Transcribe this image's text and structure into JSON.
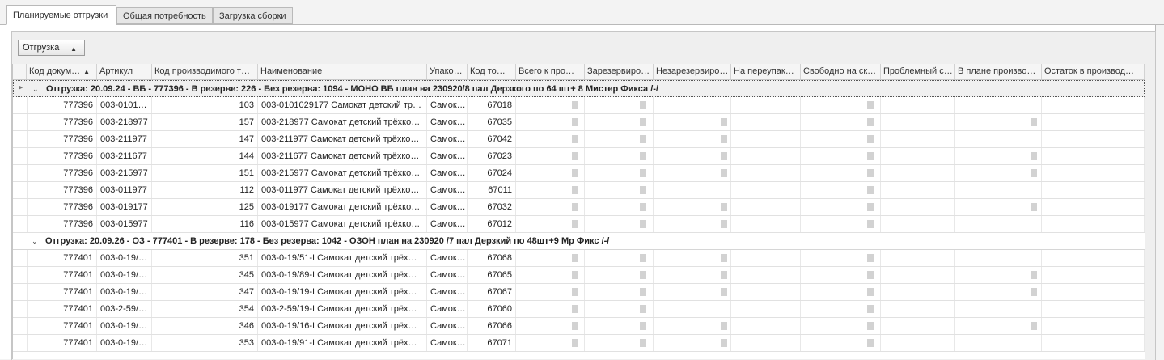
{
  "tabs": [
    {
      "label": "Планируемые отгрузки",
      "active": true
    },
    {
      "label": "Общая потребность",
      "active": false
    },
    {
      "label": "Загрузка сборки",
      "active": false
    }
  ],
  "group_panel": {
    "label": "Отгрузка",
    "sort_icon": "sort-asc-icon"
  },
  "columns": [
    {
      "label": "Код докум…",
      "sorted": true
    },
    {
      "label": "Артикул"
    },
    {
      "label": "Код производимого т…"
    },
    {
      "label": "Наименование"
    },
    {
      "label": "Упако…"
    },
    {
      "label": "Код то…"
    },
    {
      "label": "Всего к про…"
    },
    {
      "label": "Зарезервиро…"
    },
    {
      "label": "Незарезервиро…"
    },
    {
      "label": "На переупак…"
    },
    {
      "label": "Свободно на ск…"
    },
    {
      "label": "Проблемный с…"
    },
    {
      "label": "В плане произво…"
    },
    {
      "label": "Остаток в производ…"
    }
  ],
  "groups": [
    {
      "title": "Отгрузка: 20.09.24 - ВБ - 777396 - В резерве: 226 - Без резерва: 1094 - МОНО ВБ план на 230920/8 пал Дерзкого по 64 шт+ 8 Мистер Фикса /-/",
      "rows": [
        {
          "doc": "777396",
          "article": "003-0101…",
          "prod_code": "103",
          "name": "003-0101029177 Самокат детский тр…",
          "pack": "Самок…",
          "item_code": "67018"
        },
        {
          "doc": "777396",
          "article": "003-218977",
          "prod_code": "157",
          "name": "003-218977 Самокат детский трёхко…",
          "pack": "Самок…",
          "item_code": "67035"
        },
        {
          "doc": "777396",
          "article": "003-211977",
          "prod_code": "147",
          "name": "003-211977 Самокат детский трёхко…",
          "pack": "Самок…",
          "item_code": "67042"
        },
        {
          "doc": "777396",
          "article": "003-211677",
          "prod_code": "144",
          "name": "003-211677 Самокат детский трёхко…",
          "pack": "Самок…",
          "item_code": "67023"
        },
        {
          "doc": "777396",
          "article": "003-215977",
          "prod_code": "151",
          "name": "003-215977 Самокат детский трёхко…",
          "pack": "Самок…",
          "item_code": "67024"
        },
        {
          "doc": "777396",
          "article": "003-011977",
          "prod_code": "112",
          "name": "003-011977 Самокат детский трёхко…",
          "pack": "Самок…",
          "item_code": "67011"
        },
        {
          "doc": "777396",
          "article": "003-019177",
          "prod_code": "125",
          "name": "003-019177 Самокат детский трёхко…",
          "pack": "Самок…",
          "item_code": "67032"
        },
        {
          "doc": "777396",
          "article": "003-015977",
          "prod_code": "116",
          "name": "003-015977 Самокат детский трёхко…",
          "pack": "Самок…",
          "item_code": "67012"
        }
      ]
    },
    {
      "title": "Отгрузка: 20.09.26 - ОЗ - 777401 - В резерве: 178 - Без резерва: 1042 - ОЗОН  план на 230920 /7 пал Дерзкий по 48шт+9 Мр Фикс  /-/",
      "rows": [
        {
          "doc": "777401",
          "article": "003-0-19/…",
          "prod_code": "351",
          "name": "003-0-19/51-I Самокат детский трёх…",
          "pack": "Самок…",
          "item_code": "67068"
        },
        {
          "doc": "777401",
          "article": "003-0-19/…",
          "prod_code": "345",
          "name": "003-0-19/89-I Самокат детский трёх…",
          "pack": "Самок…",
          "item_code": "67065"
        },
        {
          "doc": "777401",
          "article": "003-0-19/…",
          "prod_code": "347",
          "name": "003-0-19/19-I Самокат детский трёх…",
          "pack": "Самок…",
          "item_code": "67067"
        },
        {
          "doc": "777401",
          "article": "003-2-59/…",
          "prod_code": "354",
          "name": "003-2-59/19-I Самокат детский трёх…",
          "pack": "Самок…",
          "item_code": "67060"
        },
        {
          "doc": "777401",
          "article": "003-0-19/…",
          "prod_code": "346",
          "name": "003-0-19/16-I Самокат детский трёх…",
          "pack": "Самок…",
          "item_code": "67066"
        },
        {
          "doc": "777401",
          "article": "003-0-19/…",
          "prod_code": "353",
          "name": "003-0-19/91-I Самокат детский трёх…",
          "pack": "Самок…",
          "item_code": "67071"
        }
      ]
    }
  ]
}
